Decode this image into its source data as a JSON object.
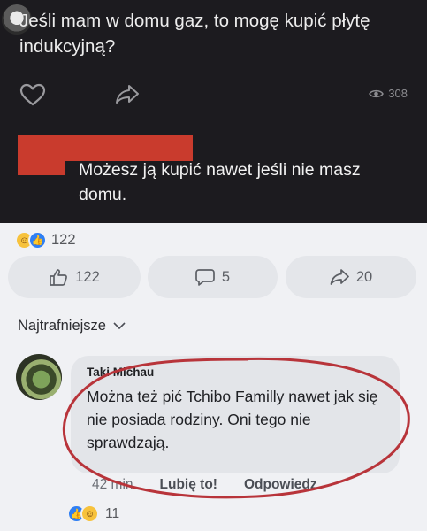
{
  "question": {
    "text": "Jeśli mam w domu gaz, to mogę kupić płytę indukcyjną?",
    "views": "308"
  },
  "answer": {
    "text": "Możesz ją kupić nawet jeśli nie masz domu."
  },
  "reactions": {
    "count": "122",
    "icons": [
      "haha-icon",
      "like-icon"
    ]
  },
  "actions": {
    "like_count": "122",
    "comment_count": "5",
    "share_count": "20"
  },
  "sort_label": "Najtrafniejsze",
  "comment": {
    "author": "Taki Michau",
    "text": "Można też pić Tchibo Familly nawet jak się nie posiada rodziny. Oni tego nie sprawdzają.",
    "time": "42 min",
    "like_label": "Lubię to!",
    "reply_label": "Odpowiedz",
    "reaction_count": "11"
  },
  "colors": {
    "dark_bg": "#1c1b1f",
    "light_bg": "#f0f1f4",
    "redaction": "#c93b2d",
    "annotation_circle": "#b8343a",
    "like_blue": "#2f7ff3"
  }
}
